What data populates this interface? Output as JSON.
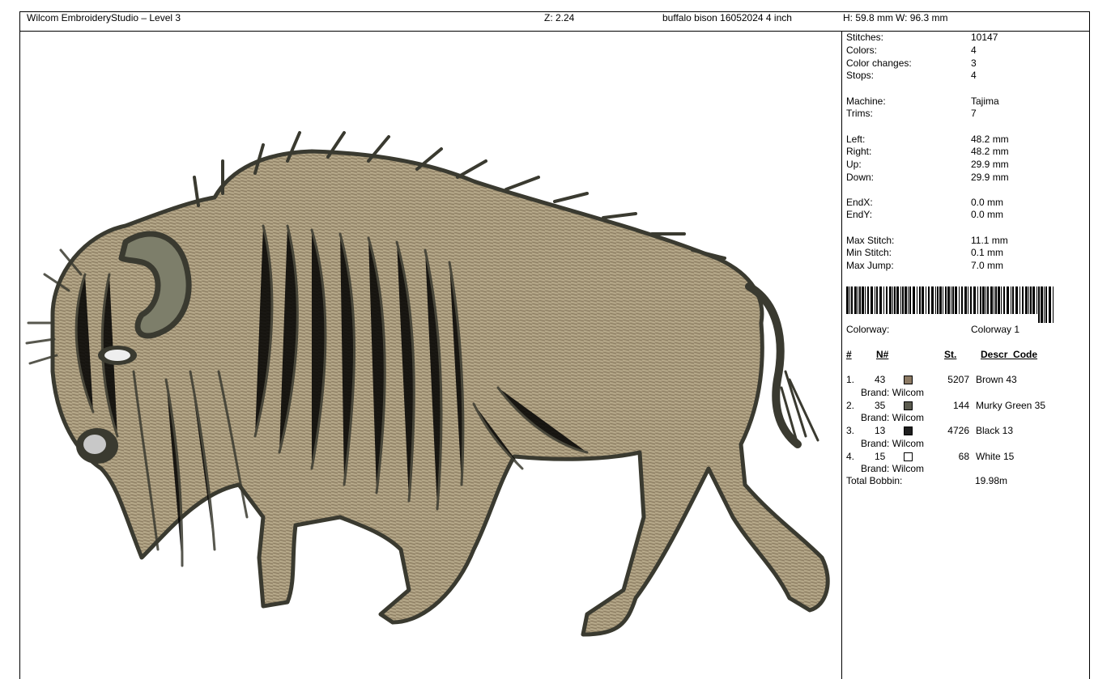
{
  "header": {
    "app_title": "Wilcom EmbroideryStudio – Level 3",
    "zoom": "Z: 2.24",
    "design_name": "buffalo bison 16052024 4 inch",
    "height": "H: 59.8 mm",
    "width": "W: 96.3 mm"
  },
  "stats": [
    {
      "label": "Stitches:",
      "value": "10147"
    },
    {
      "label": "Colors:",
      "value": "4"
    },
    {
      "label": "Color changes:",
      "value": "3"
    },
    {
      "label": "Stops:",
      "value": "4"
    },
    {
      "label": "Machine:",
      "value": "Tajima"
    },
    {
      "label": "Trims:",
      "value": "7"
    },
    {
      "label": "Left:",
      "value": "48.2 mm"
    },
    {
      "label": "Right:",
      "value": "48.2 mm"
    },
    {
      "label": "Up:",
      "value": "29.9 mm"
    },
    {
      "label": "Down:",
      "value": "29.9 mm"
    },
    {
      "label": "EndX:",
      "value": "0.0 mm"
    },
    {
      "label": "EndY:",
      "value": "0.0 mm"
    },
    {
      "label": "Max Stitch:",
      "value": "11.1 mm"
    },
    {
      "label": "Min Stitch:",
      "value": "0.1 mm"
    },
    {
      "label": "Max Jump:",
      "value": "7.0 mm"
    }
  ],
  "colorway": {
    "label": "Colorway:",
    "value": "Colorway 1"
  },
  "table_headers": {
    "num": "#",
    "n": "N#",
    "st": "St.",
    "descr": "Descr_Code"
  },
  "threads": [
    {
      "index": "1.",
      "n": "43",
      "color": "#8c7a64",
      "st": "5207",
      "descr": "Brown 43",
      "brand": "Brand: Wilcom"
    },
    {
      "index": "2.",
      "n": "35",
      "color": "#5a5a4e",
      "st": "144",
      "descr": "Murky Green 35",
      "brand": "Brand: Wilcom"
    },
    {
      "index": "3.",
      "n": "13",
      "color": "#1e1e1e",
      "st": "4726",
      "descr": "Black 13",
      "brand": "Brand: Wilcom"
    },
    {
      "index": "4.",
      "n": "15",
      "color": "#ffffff",
      "st": "68",
      "descr": "White 15",
      "brand": "Brand: Wilcom"
    }
  ],
  "total_bobbin": {
    "label": "Total Bobbin:",
    "value": "19.98m"
  },
  "colors": {
    "fill": "#a89a7c",
    "fill_dark": "#8c7d62",
    "outline": "#3a3a30",
    "horn": "#7d7e6a"
  }
}
